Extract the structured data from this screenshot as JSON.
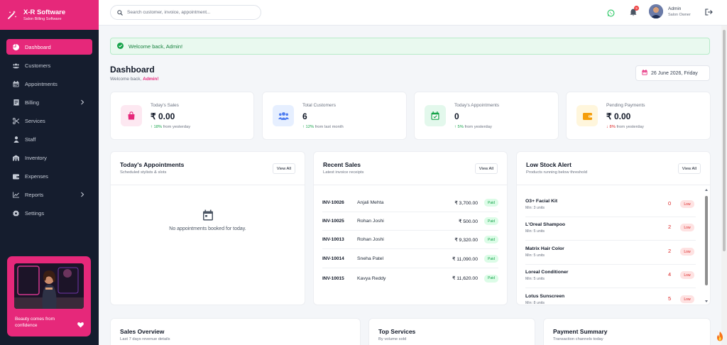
{
  "brand": {
    "title": "X-R Software",
    "subtitle": "Salon Billing Software"
  },
  "nav": {
    "items": [
      {
        "label": "Dashboard",
        "icon": "pie-chart-icon",
        "active": true
      },
      {
        "label": "Customers",
        "icon": "users-icon"
      },
      {
        "label": "Appointments",
        "icon": "calendar-icon"
      },
      {
        "label": "Billing",
        "icon": "receipt-icon",
        "chevron": true
      },
      {
        "label": "Services",
        "icon": "scissors-icon"
      },
      {
        "label": "Staff",
        "icon": "user-icon"
      },
      {
        "label": "Inventory",
        "icon": "warehouse-icon"
      },
      {
        "label": "Expenses",
        "icon": "wallet-icon"
      },
      {
        "label": "Reports",
        "icon": "line-chart-icon",
        "chevron": true
      },
      {
        "label": "Settings",
        "icon": "gear-icon"
      }
    ]
  },
  "promo": {
    "text": "Beauty comes from confidence"
  },
  "topbar": {
    "search_placeholder": "Search customer, invoice, appointment...",
    "notification_count": "9",
    "user_name": "Admin",
    "user_role": "Salon Owner"
  },
  "alert": {
    "text": "Welcome back, Admin!"
  },
  "header": {
    "title": "Dashboard",
    "subtitle_prefix": "Welcome back,",
    "subtitle_name": "Admin!",
    "date": "26 June 2026, Friday"
  },
  "stats": [
    {
      "label": "Today's Sales",
      "value": "₹ 0.00",
      "change": "↑ 18%",
      "change_text": "from yesterday",
      "trend": "up"
    },
    {
      "label": "Total Customers",
      "value": "6",
      "change": "↑ 12%",
      "change_text": "from last month",
      "trend": "up"
    },
    {
      "label": "Today's Appointments",
      "value": "0",
      "change": "↑ 5%",
      "change_text": "from yesterday",
      "trend": "up"
    },
    {
      "label": "Pending Payments",
      "value": "₹ 0.00",
      "change": "↓ 8%",
      "change_text": "from yesterday",
      "trend": "down"
    }
  ],
  "appointments_card": {
    "title": "Today's Appointments",
    "subtitle": "Scheduled stylists & slots",
    "view_all": "View All",
    "empty_text": "No appointments booked for today."
  },
  "sales_card": {
    "title": "Recent Sales",
    "subtitle": "Latest invoice receipts",
    "view_all": "View All",
    "rows": [
      {
        "id": "INV-10026",
        "name": "Anjali Mehta",
        "amount": "₹ 3,700.00",
        "status": "Paid"
      },
      {
        "id": "INV-10025",
        "name": "Rohan Joshi",
        "amount": "₹ 500.00",
        "status": "Paid"
      },
      {
        "id": "INV-10013",
        "name": "Rohan Joshi",
        "amount": "₹ 9,320.00",
        "status": "Paid"
      },
      {
        "id": "INV-10014",
        "name": "Sneha Patel",
        "amount": "₹ 11,090.00",
        "status": "Paid"
      },
      {
        "id": "INV-10015",
        "name": "Kavya Reddy",
        "amount": "₹ 11,620.00",
        "status": "Paid"
      }
    ]
  },
  "stock_card": {
    "title": "Low Stock Alert",
    "subtitle": "Products running below threshold",
    "view_all": "View All",
    "rows": [
      {
        "name": "O3+ Facial Kit",
        "min": "Min: 3 units",
        "qty": "0",
        "status": "Low"
      },
      {
        "name": "L'Oreal Shampoo",
        "min": "Min: 5 units",
        "qty": "2",
        "status": "Low"
      },
      {
        "name": "Matrix Hair Color",
        "min": "Min: 5 units",
        "qty": "2",
        "status": "Low"
      },
      {
        "name": "Loreal Conditioner",
        "min": "Min: 5 units",
        "qty": "4",
        "status": "Low"
      },
      {
        "name": "Lotus Sunscreen",
        "min": "Min: 8 units",
        "qty": "5",
        "status": "Low"
      }
    ]
  },
  "bottom_cards": [
    {
      "title": "Sales Overview",
      "subtitle": "Last 7 days revenue details"
    },
    {
      "title": "Top Services",
      "subtitle": "By volume sold"
    },
    {
      "title": "Payment Summary",
      "subtitle": "Transaction channels today"
    }
  ],
  "colors": {
    "brand": "#e6287a",
    "sidebar": "#151d2e",
    "success": "#16a34a",
    "danger": "#dc2626"
  }
}
